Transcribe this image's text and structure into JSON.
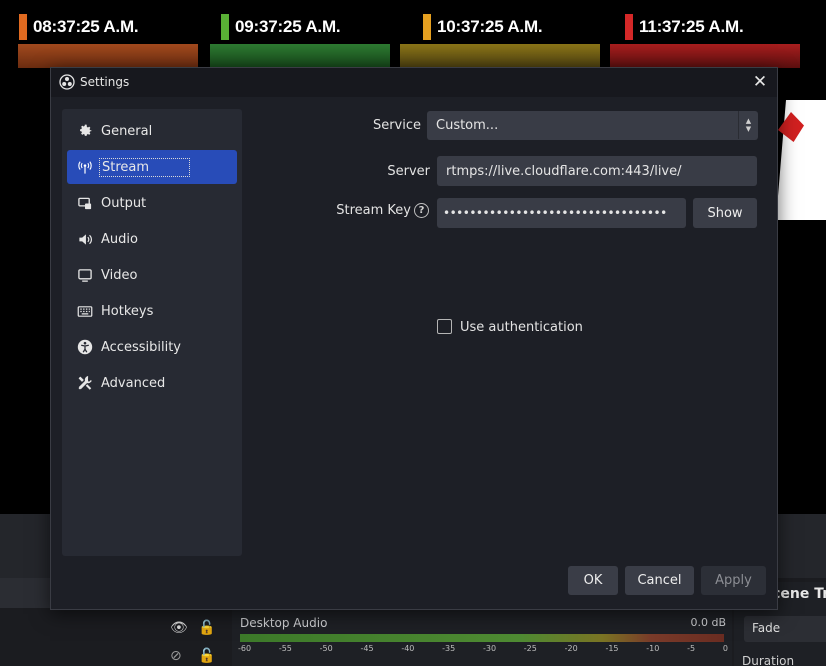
{
  "background": {
    "clocks": [
      {
        "time": "08:37:25 A.M.",
        "color": "#e06a20"
      },
      {
        "time": "09:37:25 A.M.",
        "color": "#59b035"
      },
      {
        "time": "10:37:25 A.M.",
        "color": "#e6a020"
      },
      {
        "time": "11:37:25 A.M.",
        "color": "#d42828"
      }
    ],
    "mixer": {
      "source": "Desktop Audio",
      "level": "0.0 dB",
      "ticks": [
        "-60",
        "-55",
        "-50",
        "-45",
        "-40",
        "-35",
        "-30",
        "-25",
        "-20",
        "-15",
        "-10",
        "-5",
        "0"
      ]
    },
    "transitions": {
      "title": "Scene Transitions",
      "type": "Fade",
      "duration_label": "Duration"
    }
  },
  "dialog": {
    "title": "Settings",
    "nav": [
      {
        "label": "General",
        "icon": "gear-icon"
      },
      {
        "label": "Stream",
        "icon": "antenna-icon"
      },
      {
        "label": "Output",
        "icon": "output-icon"
      },
      {
        "label": "Audio",
        "icon": "speaker-icon"
      },
      {
        "label": "Video",
        "icon": "monitor-icon"
      },
      {
        "label": "Hotkeys",
        "icon": "keyboard-icon"
      },
      {
        "label": "Accessibility",
        "icon": "accessibility-icon"
      },
      {
        "label": "Advanced",
        "icon": "tools-icon"
      }
    ],
    "active_nav": "Stream",
    "stream": {
      "service_label": "Service",
      "service_value": "Custom...",
      "server_label": "Server",
      "server_value": "rtmps://live.cloudflare.com:443/live/",
      "key_label": "Stream Key",
      "key_value": "••••••••••••••••••••••••••••••••••",
      "show_label": "Show",
      "auth_label": "Use authentication",
      "auth_checked": false
    },
    "buttons": {
      "ok": "OK",
      "cancel": "Cancel",
      "apply": "Apply"
    }
  }
}
